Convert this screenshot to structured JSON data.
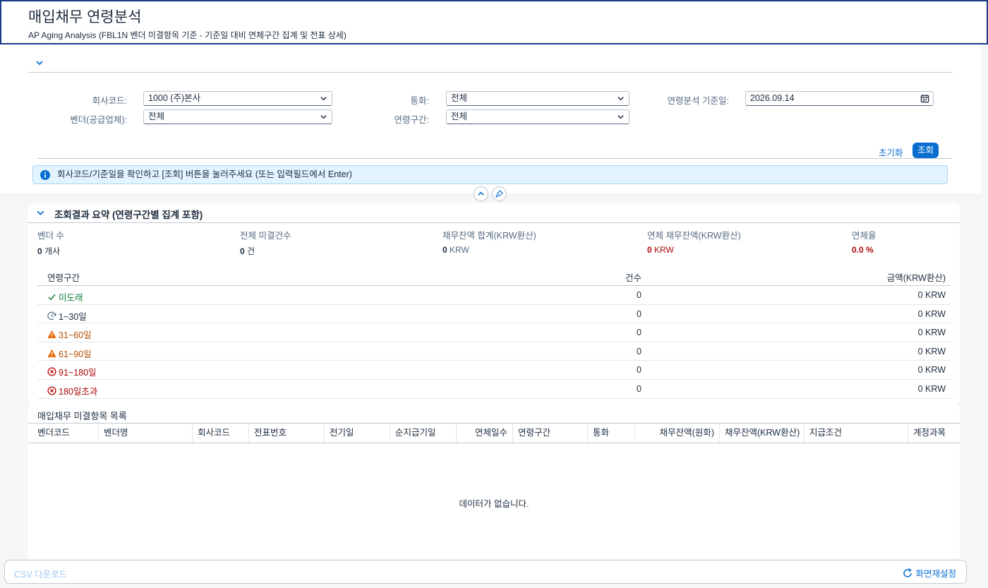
{
  "header": {
    "title": "매입채무 연령분석",
    "subtitle": "AP Aging Analysis (FBL1N 벤더 미결항목 기준 - 기준일 대비 연체구간 집계 및 전표 상세)"
  },
  "filters": {
    "company_code": {
      "label": "회사코드:",
      "value": "1000 (주)본사"
    },
    "currency": {
      "label": "통화:",
      "value": "전체"
    },
    "key_date": {
      "label": "연령분석 기준일:",
      "value": "2026.09.14"
    },
    "vendor": {
      "label": "벤더(공급업체):",
      "value": "전체"
    },
    "aging_band": {
      "label": "연령구간:",
      "value": "전체"
    },
    "reset_label": "초기화",
    "go_label": "조회"
  },
  "message": "회사코드/기준일을 확인하고 [조회] 버튼을 눌러주세요 (또는 입력필드에서 Enter)",
  "summary": {
    "title": "조회결과 요약 (연령구간별 집계 포함)",
    "kpis": [
      {
        "label": "벤더 수",
        "value": "0",
        "unit": "개사"
      },
      {
        "label": "전체 미결건수",
        "value": "0",
        "unit": "건"
      },
      {
        "label": "채무잔액 합계(KRW환산)",
        "value": "0",
        "unit": "KRW"
      },
      {
        "label": "연체 채무잔액(KRW환산)",
        "value": "0",
        "unit": "KRW"
      },
      {
        "label": "연체율",
        "value": "0.0 %",
        "unit": ""
      }
    ],
    "aging_table": {
      "headers": {
        "band": "연령구간",
        "count": "건수",
        "amount": "금액(KRW환산)"
      },
      "rows": [
        {
          "band": "미도래",
          "count": "0",
          "amount": "0 KRW",
          "status": "success",
          "icon": "check-icon",
          "color": "#107e3e"
        },
        {
          "band": "1~30일",
          "count": "0",
          "amount": "0 KRW",
          "status": "neutral",
          "icon": "clock-refresh-icon",
          "color": "#1d2d3e"
        },
        {
          "band": "31~60일",
          "count": "0",
          "amount": "0 KRW",
          "status": "warning",
          "icon": "warning-icon",
          "color": "#b44f00"
        },
        {
          "band": "61~90일",
          "count": "0",
          "amount": "0 KRW",
          "status": "warning",
          "icon": "warning-icon",
          "color": "#b44f00"
        },
        {
          "band": "91~180일",
          "count": "0",
          "amount": "0 KRW",
          "status": "error",
          "icon": "error-circle-icon",
          "color": "#aa0808"
        },
        {
          "band": "180일초과",
          "count": "0",
          "amount": "0 KRW",
          "status": "error",
          "icon": "error-circle-icon",
          "color": "#aa0808"
        }
      ]
    }
  },
  "item_list": {
    "title": "매입채무 미결항목 목록",
    "columns": [
      "벤더코드",
      "벤더명",
      "회사코드",
      "전표번호",
      "전기일",
      "순지급기일",
      "연체일수",
      "연령구간",
      "통화",
      "채무잔액(원화)",
      "채무잔액(KRW환산)",
      "지급조건",
      "계정과목"
    ],
    "empty_text": "데이터가 없습니다."
  },
  "footer": {
    "csv_label": "CSV 다운로드",
    "refresh_label": "화면재설정"
  },
  "colors": {
    "accent": "#0a6ed1",
    "error": "#aa0808",
    "warning": "#b44f00",
    "success": "#107e3e",
    "info_bg": "#e1f4ff"
  }
}
